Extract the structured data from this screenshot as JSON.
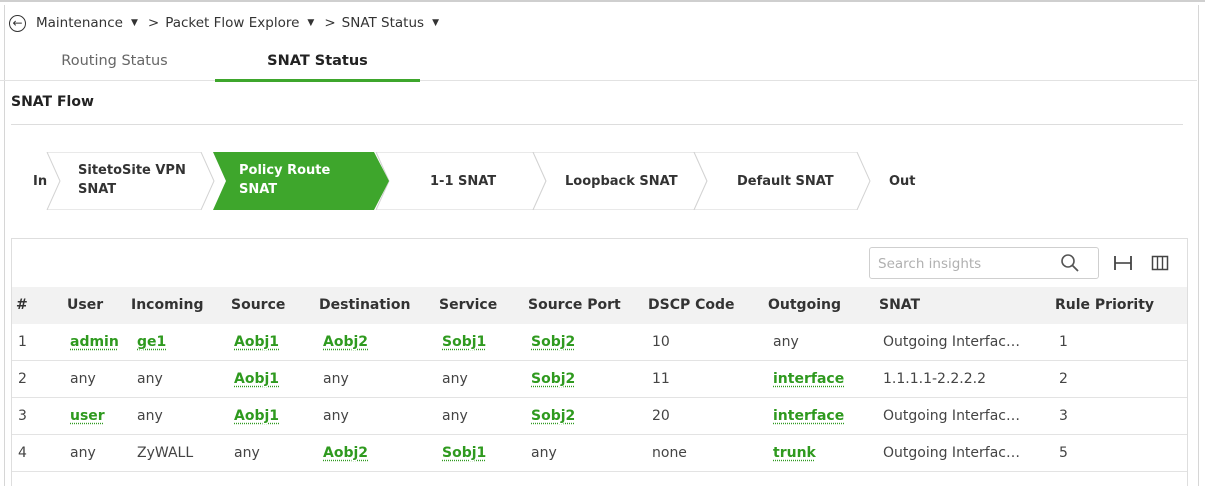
{
  "breadcrumb": {
    "items": [
      "Maintenance",
      "Packet Flow Explore",
      "SNAT Status"
    ],
    "separator": ">"
  },
  "tabs": [
    {
      "label": "Routing Status",
      "active": false
    },
    {
      "label": "SNAT Status",
      "active": true
    }
  ],
  "section_title": "SNAT Flow",
  "flow": {
    "steps": [
      {
        "label": "In",
        "active": false
      },
      {
        "label": "SitetoSite VPN SNAT",
        "line1": "SitetoSite VPN",
        "line2": "SNAT",
        "active": false
      },
      {
        "label": "Policy Route SNAT",
        "line1": "Policy Route",
        "line2": "SNAT",
        "active": true
      },
      {
        "label": "1-1 SNAT",
        "active": false
      },
      {
        "label": "Loopback SNAT",
        "active": false
      },
      {
        "label": "Default SNAT",
        "active": false
      },
      {
        "label": "Out",
        "active": false
      }
    ],
    "active_color": "#3ea62c"
  },
  "toolbar": {
    "search_placeholder": "Search insights",
    "icons": [
      "search-icon",
      "fit-columns-icon",
      "columns-icon"
    ]
  },
  "table": {
    "columns": [
      "#",
      "User",
      "Incoming",
      "Source",
      "Destination",
      "Service",
      "Source Port",
      "DSCP Code",
      "Outgoing",
      "SNAT",
      "Rule Priority"
    ],
    "rows": [
      [
        "1",
        "admin",
        "ge1",
        "Aobj1",
        "Aobj2",
        "Sobj1",
        "Sobj2",
        "10",
        "any",
        "Outgoing Interfac…",
        "1"
      ],
      [
        "2",
        "any",
        "any",
        "Aobj1",
        "any",
        "any",
        "Sobj2",
        "11",
        "interface",
        "1.1.1.1-2.2.2.2",
        "2"
      ],
      [
        "3",
        "user",
        "any",
        "Aobj1",
        "any",
        "any",
        "Sobj2",
        "20",
        "interface",
        "Outgoing Interfac…",
        "3"
      ],
      [
        "4",
        "any",
        "ZyWALL",
        "any",
        "Aobj2",
        "Sobj1",
        "any",
        "none",
        "trunk",
        "Outgoing Interfac…",
        "5"
      ]
    ],
    "link_color": "#2f9a1f"
  }
}
